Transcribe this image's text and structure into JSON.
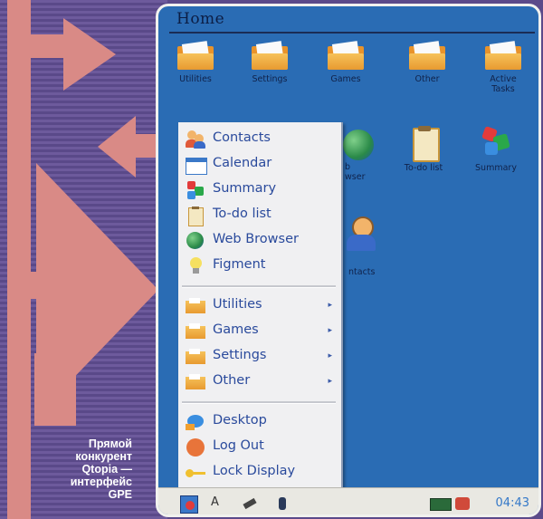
{
  "caption": {
    "line1": "Прямой",
    "line2": "конкурент",
    "line3": "Qtopia —",
    "line4": "интерфейс",
    "line5": "GPE"
  },
  "window": {
    "title": "Home"
  },
  "desktop": {
    "folders": [
      {
        "label": "Utilities",
        "icon": "folder-icon"
      },
      {
        "label": "Settings",
        "icon": "folder-icon"
      },
      {
        "label": "Games",
        "icon": "folder-icon"
      },
      {
        "label": "Other",
        "icon": "folder-icon"
      },
      {
        "label": "Active Tasks",
        "icon": "folder-icon"
      }
    ],
    "apps": [
      {
        "label": "To-do list",
        "icon": "clipboard-icon"
      },
      {
        "label": "Summary",
        "icon": "summary-icon"
      },
      {
        "label": "ntacts",
        "icon": "contacts-icon"
      }
    ],
    "partial_labels": {
      "web_browser_fragment1": "b",
      "web_browser_fragment2": "wser"
    }
  },
  "menu": {
    "apps": [
      {
        "label": "Contacts",
        "icon": "contacts-icon"
      },
      {
        "label": "Calendar",
        "icon": "calendar-icon"
      },
      {
        "label": "Summary",
        "icon": "summary-icon"
      },
      {
        "label": "To-do list",
        "icon": "clipboard-icon"
      },
      {
        "label": "Web Browser",
        "icon": "globe-icon"
      },
      {
        "label": "Figment",
        "icon": "lightbulb-icon"
      }
    ],
    "folders": [
      {
        "label": "Utilities",
        "icon": "folder-icon",
        "submenu": "▸"
      },
      {
        "label": "Games",
        "icon": "folder-icon",
        "submenu": "▸"
      },
      {
        "label": "Settings",
        "icon": "folder-icon",
        "submenu": "▸"
      },
      {
        "label": "Other",
        "icon": "folder-icon",
        "submenu": "▸"
      }
    ],
    "system": [
      {
        "label": "Desktop",
        "icon": "desktop-icon"
      },
      {
        "label": "Log Out",
        "icon": "logout-icon"
      },
      {
        "label": "Lock Display",
        "icon": "key-icon"
      }
    ]
  },
  "taskbar": {
    "clock": "04:43",
    "icons": [
      "start-menu-icon",
      "keyboard-icon",
      "stylus-icon",
      "pen-icon",
      "battery-icon",
      "network-icon"
    ]
  },
  "colors": {
    "desktop_bg": "#2a6cb4",
    "menu_text": "#2a4a9c",
    "clock": "#3478c8",
    "arrow": "#d98a86",
    "strip_bg": "#6d5a9c"
  }
}
